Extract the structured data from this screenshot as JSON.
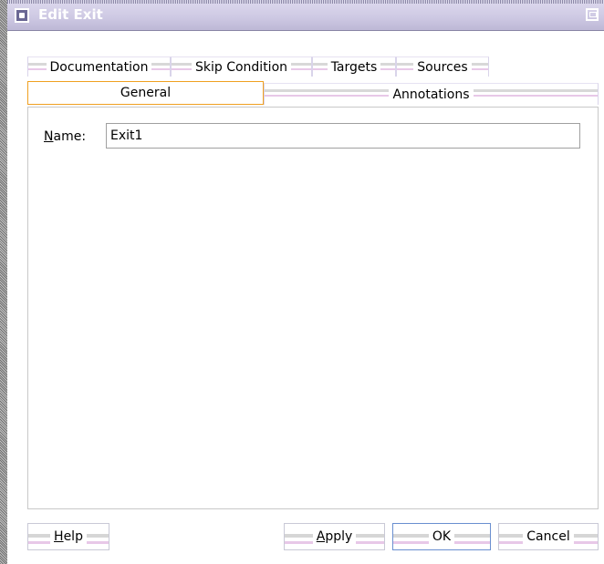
{
  "window": {
    "title": "Edit Exit",
    "app_icon": "window-menu-icon",
    "restore_icon": "restore-icon"
  },
  "tabs": {
    "row1": [
      "Documentation",
      "Skip Condition",
      "Targets",
      "Sources"
    ],
    "row2": [
      "General",
      "Annotations"
    ],
    "selected": "General"
  },
  "general": {
    "name_label_mnemonic": "N",
    "name_label_rest": "ame:",
    "name_value": "Exit1"
  },
  "buttons": {
    "help_mnemonic": "H",
    "help_rest": "elp",
    "apply_mnemonic": "A",
    "apply_rest": "pply",
    "ok": "OK",
    "cancel": "Cancel"
  },
  "colors": {
    "titlebar": "#c4c0dd",
    "selected_tab_border": "#f0a020",
    "default_button_border": "#6a8fd0"
  }
}
